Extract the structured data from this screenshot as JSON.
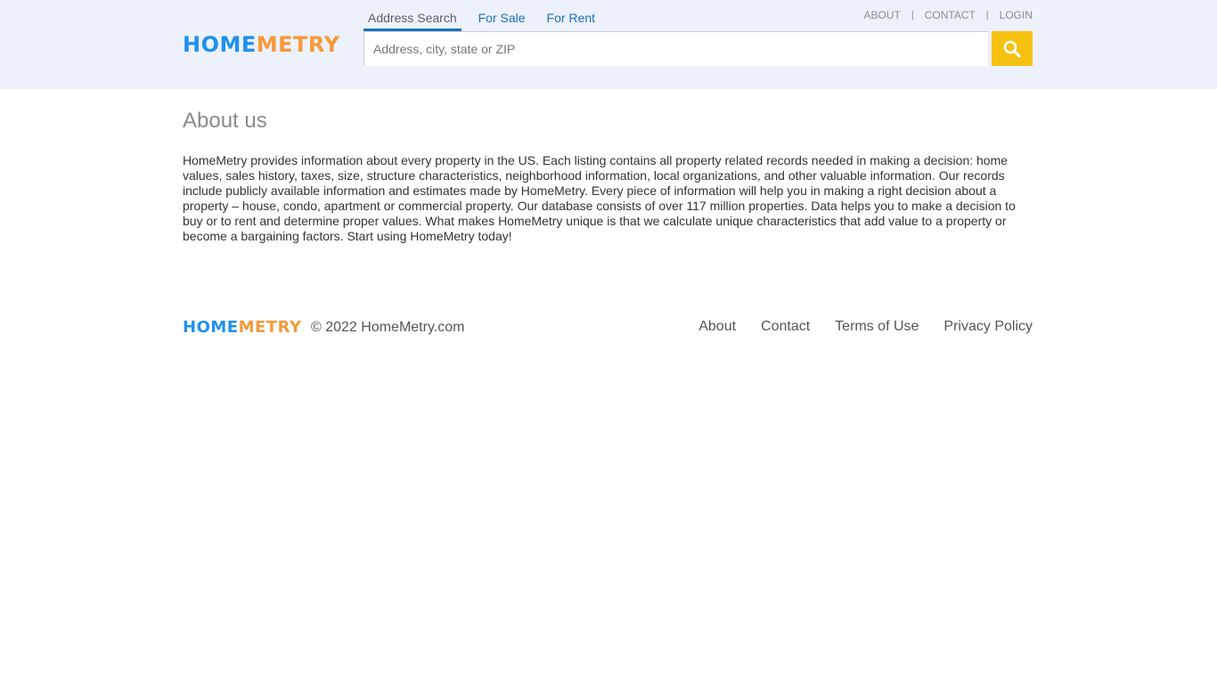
{
  "header": {
    "logo": {
      "part1": "HOME",
      "part2": "METRY"
    },
    "tabs": [
      {
        "label": "Address Search",
        "active": true
      },
      {
        "label": "For Sale",
        "active": false
      },
      {
        "label": "For Rent",
        "active": false
      }
    ],
    "search": {
      "placeholder": "Address, city, state or ZIP",
      "value": "",
      "button_icon": "search-icon"
    },
    "top_links": [
      {
        "label": "ABOUT"
      },
      {
        "label": "CONTACT"
      },
      {
        "label": "LOGIN"
      }
    ],
    "separator": "|"
  },
  "main": {
    "title": "About us",
    "body": "HomeMetry provides information about every property in the US. Each listing contains all property related records needed in making a decision: home values, sales history, taxes, size, structure characteristics, neighborhood information, local organizations, and other valuable information. Our records include publicly available information and estimates made by HomeMetry. Every piece of information will help you in making a right decision about a property – house, condo, apartment or commercial property. Our database consists of over 117 million properties. Data helps you to make a decision to buy or to rent and determine proper values. What makes HomeMetry unique is that we calculate unique characteristics that add value to a property or become a bargaining factors. Start using HomeMetry today!"
  },
  "footer": {
    "logo": {
      "part1": "HOME",
      "part2": "METRY"
    },
    "copyright": "© 2022 HomeMetry.com",
    "links": [
      {
        "label": "About"
      },
      {
        "label": "Contact"
      },
      {
        "label": "Terms of Use"
      },
      {
        "label": "Privacy Policy"
      }
    ]
  },
  "colors": {
    "header_bg": "#edf1fc",
    "brand_blue": "#2090f0",
    "brand_orange": "#f59a3b",
    "search_button": "#f5c010",
    "tab_link": "#1a72c0"
  }
}
